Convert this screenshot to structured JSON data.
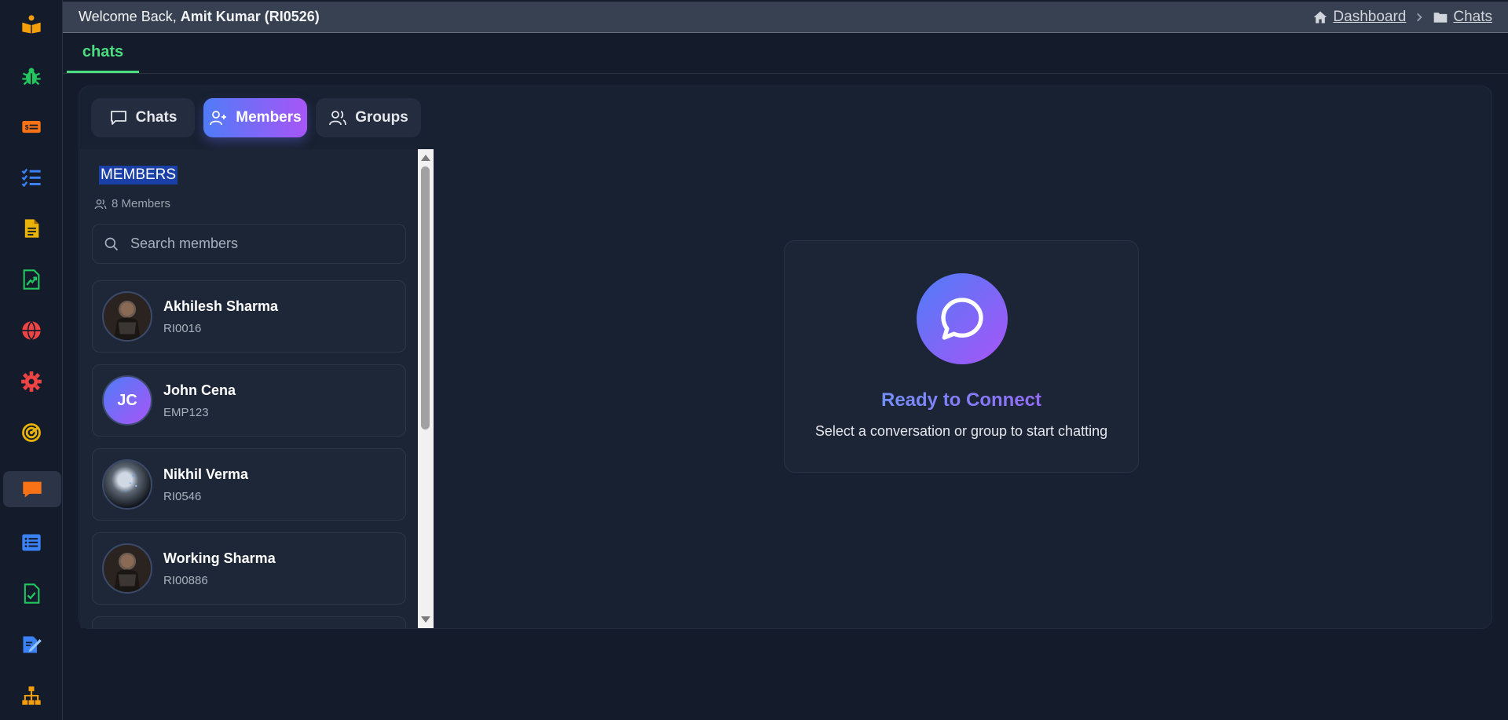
{
  "header": {
    "welcome_prefix": "Welcome Back, ",
    "user": "Amit Kumar (RI0526)",
    "breadcrumb": [
      "Dashboard",
      "Chats"
    ]
  },
  "page_tab": "chats",
  "segments": [
    "Chats",
    "Members",
    "Groups"
  ],
  "active_segment": "Members",
  "members_panel": {
    "title": "MEMBERS",
    "count_label": "8 Members",
    "search_placeholder": "Search members",
    "members": [
      {
        "name": "Akhilesh Sharma",
        "id": "RI0016",
        "avatar": "photo"
      },
      {
        "name": "John Cena",
        "id": "EMP123",
        "avatar": "initials",
        "initials": "JC"
      },
      {
        "name": "Nikhil Verma",
        "id": "RI0546",
        "avatar": "photo"
      },
      {
        "name": "Working Sharma",
        "id": "RI00886",
        "avatar": "photo"
      }
    ]
  },
  "empty_state": {
    "title": "Ready to Connect",
    "subtitle": "Select a conversation or group to start chatting"
  },
  "sidebar_icons": [
    {
      "icon": "book-reader-icon",
      "color": "#f59e0b"
    },
    {
      "icon": "bug-icon",
      "color": "#22c55e"
    },
    {
      "icon": "money-card-icon",
      "color": "#f97316"
    },
    {
      "icon": "checklist-icon",
      "color": "#3b82f6"
    },
    {
      "icon": "document-icon",
      "color": "#eab308"
    },
    {
      "icon": "chart-file-icon",
      "color": "#22c55e"
    },
    {
      "icon": "globe-icon",
      "color": "#ef4444"
    },
    {
      "icon": "gear-icon",
      "color": "#ef4444"
    },
    {
      "icon": "radar-icon",
      "color": "#eab308"
    },
    {
      "icon": "chat-icon",
      "color": "#f97316"
    },
    {
      "icon": "list-icon",
      "color": "#3b82f6"
    },
    {
      "icon": "file-check-icon",
      "color": "#22c55e"
    },
    {
      "icon": "edit-file-icon",
      "color": "#3b82f6"
    },
    {
      "icon": "org-chart-icon",
      "color": "#f59e0b"
    }
  ],
  "colors": {
    "accent_green": "#4ade80",
    "gradient_start": "#4f7cf7",
    "gradient_end": "#a855f7",
    "background": "#141c2b"
  }
}
